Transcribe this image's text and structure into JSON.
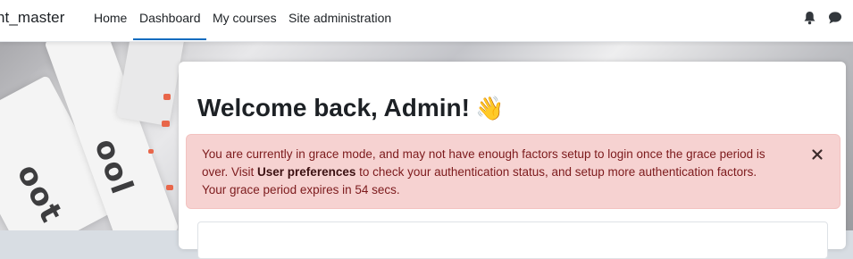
{
  "navbar": {
    "brand": "nt_master",
    "items": [
      {
        "label": "Home"
      },
      {
        "label": "Dashboard"
      },
      {
        "label": "My courses"
      },
      {
        "label": "Site administration"
      }
    ],
    "active_index": 1,
    "icons": [
      "bell-icon",
      "chat-bubble-icon"
    ]
  },
  "main": {
    "welcome": "Welcome back, Admin!",
    "welcome_emoji": "👋",
    "alert": {
      "text_before": "You are currently in grace mode, and may not have enough factors setup to login once the grace period is over. Visit ",
      "link": "User preferences",
      "text_after": " to check your authentication status, and setup more authentication factors.",
      "line3": "Your grace period expires in 54 secs.",
      "close_label": "×"
    }
  },
  "colors": {
    "accent": "#0f6cbf",
    "alert_bg": "#f6d2d1",
    "alert_text": "#7c1a1c"
  }
}
